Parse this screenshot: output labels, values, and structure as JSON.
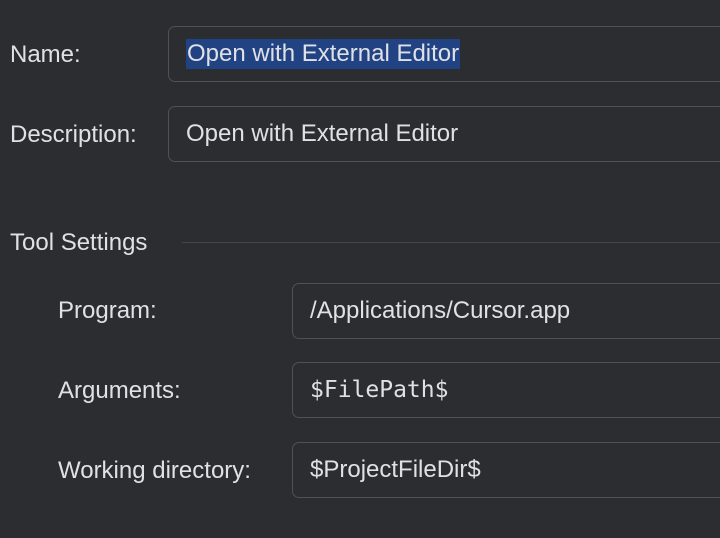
{
  "name": {
    "label": "Name:",
    "value": "Open with External Editor"
  },
  "description": {
    "label": "Description:",
    "value": "Open with External Editor"
  },
  "tool_settings": {
    "title": "Tool Settings",
    "program": {
      "label": "Program:",
      "value": "/Applications/Cursor.app"
    },
    "arguments": {
      "label": "Arguments:",
      "value": "$FilePath$"
    },
    "working_directory": {
      "label": "Working directory:",
      "value": "$ProjectFileDir$"
    }
  },
  "colors": {
    "background": "#2b2d30",
    "field_border": "#4e5157",
    "text": "#dfe1e5",
    "selection": "#214283"
  }
}
